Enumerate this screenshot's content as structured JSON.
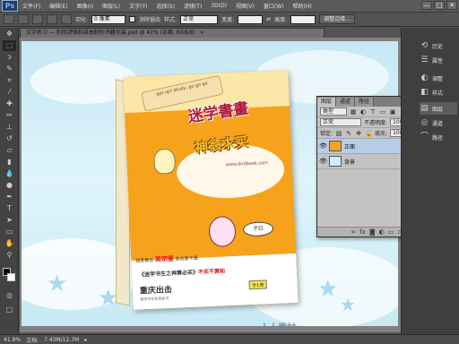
{
  "app": {
    "logo": "Ps"
  },
  "menu": [
    "文件(F)",
    "编辑(E)",
    "图像(I)",
    "图层(L)",
    "文字(Y)",
    "选择(S)",
    "滤镜(T)",
    "3D(D)",
    "视图(V)",
    "窗口(W)",
    "帮助(H)"
  ],
  "window_controls": {
    "minimize": "—",
    "maximize": "□",
    "close": "✕"
  },
  "options_bar": {
    "feather_label": "羽化:",
    "feather_value": "0 像素",
    "antialias_label": "消除锯齿",
    "style_label": "样式:",
    "style_value": "正常",
    "width_label": "宽度:",
    "height_label": "高度:",
    "refine_button": "调整边缘..."
  },
  "document": {
    "tab_title": "文字练习 — 利用滤镜和自由制作书籍包装.psd @ 41% (正面, RGB/8)",
    "tab_close": "×"
  },
  "book": {
    "eng_text": "get up! study, go go go",
    "title": "迷学書畫",
    "subtitle": "神翁求买",
    "url": "www.dndbook.com",
    "speech": "子曰",
    "line1_prefix": "独家推出 ",
    "line1_author": "吴宗鉴",
    "line1_suffix": " 卷创意卡通",
    "line2_prefix": "《迷学书生之神算必买》",
    "line2_hl": "不买不算知",
    "publisher": "重庆出击",
    "badge": "全1册",
    "small_text": "迷学书生系列丛书"
  },
  "statusbar": {
    "zoom": "41.9%",
    "doc_label": "文档:",
    "doc_size": "7.43M/12.7M"
  },
  "watermark": "人人素材",
  "layers_panel": {
    "tabs": [
      "图层",
      "通道",
      "路径"
    ],
    "kind_label": "类型",
    "blend_mode": "正常",
    "opacity_label": "不透明度:",
    "opacity_value": "100%",
    "lock_label": "锁定:",
    "fill_label": "填充:",
    "fill_value": "100%",
    "layers": [
      {
        "name": "正面",
        "selected": true
      },
      {
        "name": "背景",
        "selected": false
      }
    ]
  },
  "dock": [
    {
      "icon": "history-icon",
      "glyph": "⟲",
      "label": "历史"
    },
    {
      "icon": "properties-icon",
      "glyph": "☰",
      "label": "属性"
    },
    {
      "icon": "adjustments-icon",
      "glyph": "◐",
      "label": "调整"
    },
    {
      "icon": "styles-icon",
      "glyph": "◧",
      "label": "样式"
    },
    {
      "icon": "layers-icon",
      "glyph": "▤",
      "label": "图层",
      "selected": true
    },
    {
      "icon": "channels-icon",
      "glyph": "◎",
      "label": "通道"
    },
    {
      "icon": "paths-icon",
      "glyph": "⌒",
      "label": "路径"
    }
  ],
  "colors": {
    "foreground": "#000000",
    "background": "#ffffff",
    "accent_book": "#f6a21b"
  }
}
